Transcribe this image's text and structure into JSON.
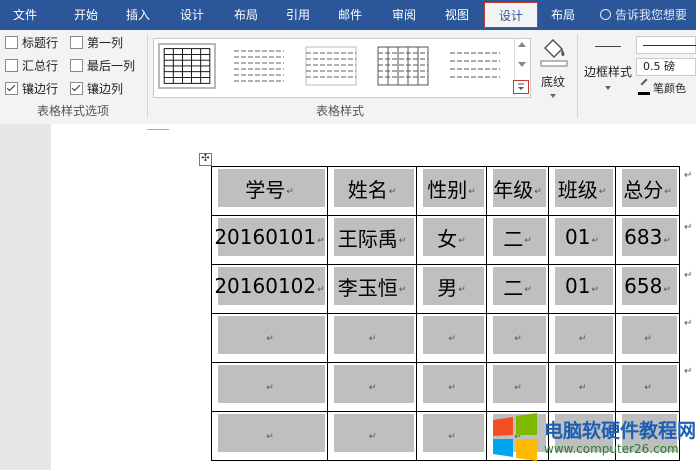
{
  "tabs": [
    {
      "label": "文件"
    },
    {
      "label": "开始"
    },
    {
      "label": "插入"
    },
    {
      "label": "设计"
    },
    {
      "label": "布局"
    },
    {
      "label": "引用"
    },
    {
      "label": "邮件"
    },
    {
      "label": "审阅"
    },
    {
      "label": "视图"
    },
    {
      "label": "设计",
      "active": true
    },
    {
      "label": "布局"
    }
  ],
  "tell_me": "告诉我您想要",
  "options": {
    "header_row": "标题行",
    "total_row": "汇总行",
    "banded_rows": "镶边行",
    "first_column": "第一列",
    "last_column": "最后一列",
    "banded_columns": "镶边列",
    "group_label": "表格样式选项"
  },
  "styles": {
    "group_label": "表格样式"
  },
  "shading": {
    "label": "底纹"
  },
  "borders": {
    "label": "边框样式",
    "weight": "0.5 磅",
    "pen_color": "笔颜色"
  },
  "table": {
    "headers": [
      "学号",
      "姓名",
      "性别",
      "年级",
      "班级",
      "总分"
    ],
    "rows": [
      [
        "20160101",
        "王际禹",
        "女",
        "二",
        "01",
        "683"
      ],
      [
        "20160102",
        "李玉恒",
        "男",
        "二",
        "01",
        "658"
      ]
    ],
    "paragraph_mark": "↵"
  },
  "watermark": {
    "title": "电脑软硬件教程网",
    "url": "www.computer26.com"
  },
  "colors": {
    "accent": "#2b579a",
    "highlight": "#c0392b",
    "cell_shade": "#bfbfbf"
  }
}
